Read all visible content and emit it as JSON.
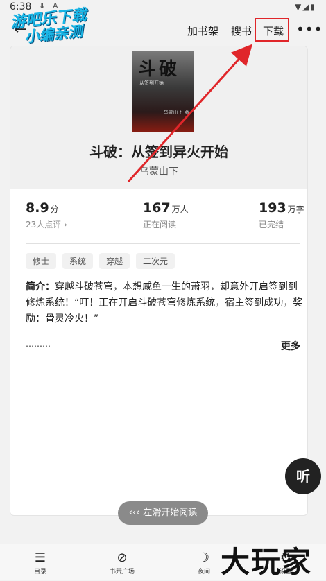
{
  "status_bar": {
    "time": "6:38",
    "download_icon": "⬇",
    "app_icon": "A",
    "right_icons": "▼◢▮"
  },
  "watermark": {
    "line1": "游吧乐下载",
    "line2": "小编亲测"
  },
  "top_bar": {
    "back_icon": "arrow-left-icon",
    "add_shelf": "加书架",
    "search_book": "搜书",
    "download": "下载",
    "more_icon": "more-dots-icon"
  },
  "book": {
    "cover": {
      "title": "斗破",
      "subtitle": "从签到开始",
      "author_mark": "乌蒙山下 著"
    },
    "title": "斗破：从签到异火开始",
    "author": "乌蒙山下",
    "stats": [
      {
        "value": "8.9",
        "unit": "分",
        "sub": "23人点评 ›"
      },
      {
        "value": "167",
        "unit": "万人",
        "sub": "正在阅读"
      },
      {
        "value": "193",
        "unit": "万字",
        "sub": "已完结"
      }
    ],
    "tags": [
      "修士",
      "系统",
      "穿越",
      "二次元"
    ],
    "synopsis_label": "简介：",
    "synopsis": "穿越斗破苍穹，本想咸鱼一生的萧羽，却意外开启签到到修炼系统！“叮！正在开启斗破苍穹修炼系统，宿主签到成功，奖励：骨灵冷火！”",
    "ellipsis": "………",
    "more": "更多"
  },
  "listen_button": "听",
  "swipe_hint": {
    "arrow": "‹‹‹",
    "text": "左滑开始阅读"
  },
  "bottom_nav": [
    {
      "label": "目录",
      "icon": "catalog-icon"
    },
    {
      "label": "书荒广场",
      "icon": "planet-icon"
    },
    {
      "label": "夜间",
      "icon": "moon-icon"
    },
    {
      "label": "设置",
      "icon": "gear-icon"
    }
  ],
  "corner_watermark": "大玩家",
  "annotation": {
    "color": "#e0262a"
  }
}
